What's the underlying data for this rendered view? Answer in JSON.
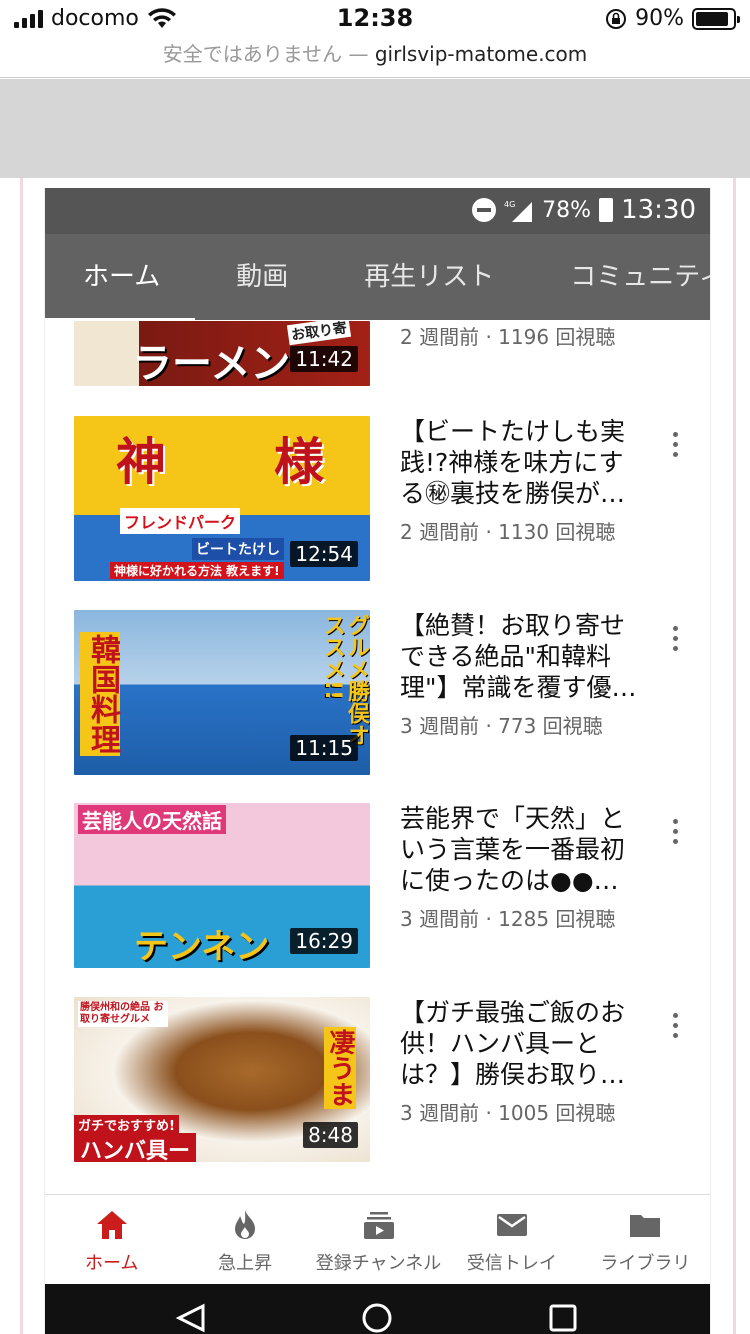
{
  "ios_status": {
    "carrier": "docomo",
    "time": "12:38",
    "battery": "90%",
    "battery_level": 0.9
  },
  "browser": {
    "insecure_label": "安全ではありません",
    "separator": "—",
    "domain": "girlsvip-matome.com"
  },
  "app_status": {
    "network": "4G",
    "battery": "78%",
    "time": "13:30"
  },
  "tabs": [
    {
      "label": "ホーム"
    },
    {
      "label": "動画"
    },
    {
      "label": "再生リスト"
    },
    {
      "label": "コミュニティ"
    }
  ],
  "videos": [
    {
      "title": "",
      "meta": "2 週間前 · 1196 回視聴",
      "duration": "11:42",
      "thumb_text": "ラーメン",
      "thumb_text2": "お取り寄",
      "colors": [
        "#7a1a12",
        "#f1e6d2"
      ]
    },
    {
      "title": "【ビートたけしも実践!?神様を味方にする㊙裏技を勝俣が…",
      "meta": "2 週間前 · 1130 回視聴",
      "duration": "12:54",
      "thumb_text": "神",
      "thumb_text2": "様",
      "thumb_text3": "フレンドパーク",
      "thumb_text4": "ビートたけし",
      "thumb_text5": "神様に好かれる方法 教えます!",
      "colors": [
        "#f5c518",
        "#2a73c8"
      ]
    },
    {
      "title": "【絶賛！お取り寄せできる絶品\"和韓料理\"】常識を覆す優…",
      "meta": "3 週間前 · 773 回視聴",
      "duration": "11:15",
      "thumb_text": "韓国料理",
      "thumb_text2": "グルメ勝俣オススメ!!",
      "colors": [
        "#8ab6de",
        "#2a73c8"
      ]
    },
    {
      "title": "芸能界で「天然」という言葉を一番最初に使ったのは●●…",
      "meta": "3 週間前 · 1285 回視聴",
      "duration": "16:29",
      "thumb_text": "芸能人の天然話",
      "thumb_text2": "テンネン",
      "colors": [
        "#f3c7dc",
        "#2a9fd6"
      ]
    },
    {
      "title": "【ガチ最強ご飯のお供！ハンバ具ーとは？】勝俣お取り…",
      "meta": "3 週間前 · 1005 回視聴",
      "duration": "8:48",
      "thumb_text": "凄うま",
      "thumb_text2": "ハンバ具ー",
      "thumb_text3": "ガチでおすすめ!",
      "thumb_text4": "勝俣州和の絶品 お取り寄せグルメ",
      "colors": [
        "#f7f2ea",
        "#c9302c"
      ]
    }
  ],
  "bottom_nav": [
    {
      "label": "ホーム",
      "icon": "home-icon",
      "active": true
    },
    {
      "label": "急上昇",
      "icon": "fire-icon"
    },
    {
      "label": "登録チャンネル",
      "icon": "subscriptions-icon"
    },
    {
      "label": "受信トレイ",
      "icon": "mail-icon"
    },
    {
      "label": "ライブラリ",
      "icon": "folder-icon"
    }
  ],
  "accent_color": "#cc1d1d"
}
